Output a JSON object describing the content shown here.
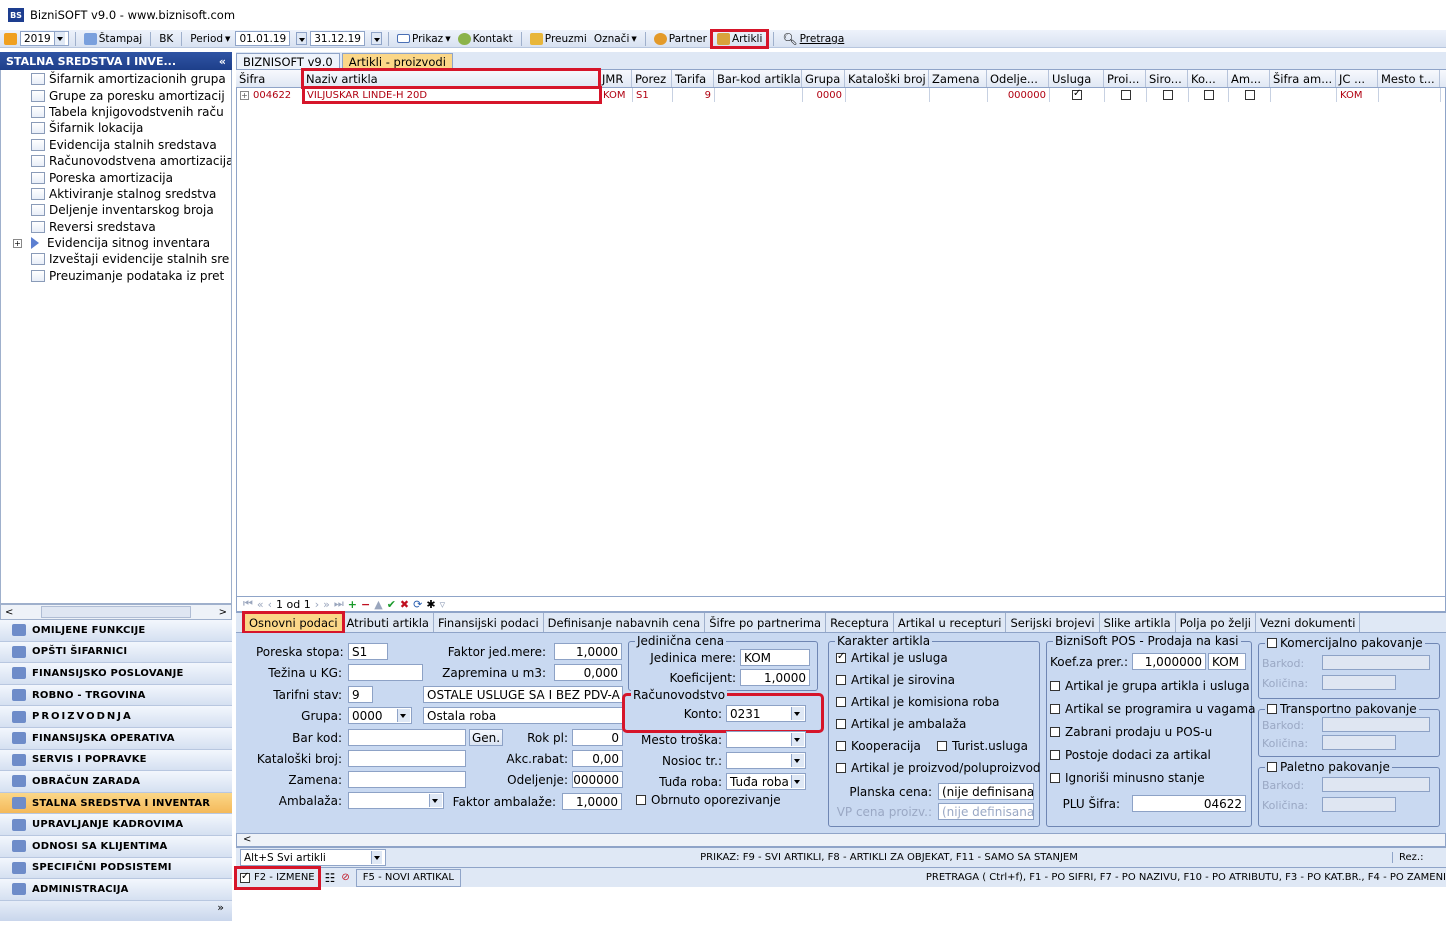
{
  "app": {
    "title": "BizniSOFT v9.0 - www.biznisoft.com",
    "icon": "BS"
  },
  "toolbar": {
    "year": "2019",
    "stampaj": "Štampaj",
    "bk": "BK",
    "period": "Period",
    "from": "01.01.19",
    "to": "31.12.19",
    "prikaz": "Prikaz",
    "kontakt": "Kontakt",
    "preuzmi": "Preuzmi",
    "oznaci": "Označi",
    "partner": "Partner",
    "artikli": "Artikli",
    "pretraga": "Pretraga"
  },
  "left": {
    "header": "STALNA SREDSTVA I INVE...",
    "collapse": "«",
    "tree": [
      "Šifarnik amortizacionih grupa",
      "Grupe za poresku amortizacij",
      "Tabela knjigovodstvenih raču",
      "Šifarnik lokacija",
      "Evidencija stalnih sredstava",
      "Računovodstvena amortizacija",
      "Poreska amortizacija",
      "Aktiviranje stalnog sredstva",
      "Deljenje inventarskog broja",
      "Reversi sredstava",
      "Evidencija sitnog inventara",
      "Izveštaji evidencije stalnih sre",
      "Preuzimanje podataka iz pret"
    ],
    "modules": [
      "OMILJENE FUNKCIJE",
      "OPŠTI ŠIFARNICI",
      "FINANSIJSKO POSLOVANJE",
      "ROBNO - TRGOVINA",
      "PROIZVODNJA",
      "FINANSIJSKA OPERATIVA",
      "SERVIS I POPRAVKE",
      "OBRAČUN ZARADA",
      "STALNA SREDSTVA I INVENTAR",
      "UPRAVLJANJE KADROVIMA",
      "ODNOSI SA KLIJENTIMA",
      "SPECIFIČNI PODSISTEMI",
      "ADMINISTRACIJA"
    ],
    "bottom": "»"
  },
  "tabs": [
    "BIZNISOFT v9.0",
    "Artikli - proizvodi"
  ],
  "grid": {
    "headers": [
      "Šifra",
      "Naziv artikla",
      "JMR",
      "Porez",
      "Tarifa",
      "Bar-kod artikla",
      "Grupa",
      "Kataloški broj",
      "Zamena",
      "Odelje...",
      "Usluga",
      "Proi...",
      "Siro...",
      "Ko...",
      "Am...",
      "Šifra am...",
      "JC ...",
      "Mesto t..."
    ],
    "row": {
      "sifra": "004622",
      "naziv": "VILJUSKAR LINDE-H 20D",
      "jmr": "KOM",
      "porez": "S1",
      "tarifa": "9",
      "grupa": "0000",
      "odeljenje": "000000",
      "jc": "KOM"
    }
  },
  "nav": {
    "pages": "1 od 1"
  },
  "detail_tabs": [
    "Osnovni podaci",
    "Atributi artikla",
    "Finansijski podaci",
    "Definisanje nabavnih cena",
    "Šifre po partnerima",
    "Receptura",
    "Artikal u recepturi",
    "Serijski brojevi",
    "Slike artikla",
    "Polja po želji",
    "Vezni dokumenti"
  ],
  "form": {
    "poreska_stopa_l": "Poreska stopa:",
    "poreska_stopa": "S1",
    "tezina_l": "Težina u KG:",
    "tarifni_l": "Tarifni stav:",
    "tarifni": "9",
    "tarifni_opis": "OSTALE USLUGE SA I BEZ PDV-A",
    "grupa_l": "Grupa:",
    "grupa": "0000",
    "grupa_opis": "Ostala roba",
    "barkod_l": "Bar kod:",
    "gen": "Gen.",
    "rok_l": "Rok pl:",
    "rok": "0",
    "katbroj_l": "Kataloški broj:",
    "akc_l": "Akc.rabat:",
    "akc": "0,00",
    "zamena_l": "Zamena:",
    "odelj_l": "Odeljenje:",
    "odelj": "000000",
    "ambalaza_l": "Ambalaža:",
    "faktor_amb_l": "Faktor ambalaže:",
    "faktor_amb": "1,0000",
    "faktor_jm_l": "Faktor jed.mere:",
    "faktor_jm": "1,0000",
    "zapremina_l": "Zapremina u m3:",
    "zapremina": "0,000",
    "jc_title": "Jedinična cena",
    "jm_l": "Jedinica mere:",
    "jm": "KOM",
    "koef_l": "Koeficijent:",
    "koef": "1,0000",
    "rac_title": "Računovodstvo",
    "konto_l": "Konto:",
    "konto": "0231",
    "mesto_l": "Mesto troška:",
    "nosioc_l": "Nosioc tr.:",
    "tudja_l": "Tuđa roba:",
    "tudja": "Tuđa roba",
    "obrnuto": "Obrnuto oporezivanje",
    "kar_title": "Karakter artikla",
    "k1": "Artikal je usluga",
    "k2": "Artikal je sirovina",
    "k3": "Artikal je komisiona roba",
    "k4": "Artikal je ambalaža",
    "k5": "Kooperacija",
    "k5b": "Turist.usluga",
    "k6": "Artikal je proizvod/poluproizvod",
    "planska_l": "Planska cena:",
    "planska": "(nije definisana)",
    "vp_l": "VP cena proizv.:",
    "vp": "(nije definisana)",
    "pos_title": "BizniSoft POS - Prodaja na kasi",
    "koefp_l": "Koef.za prer.:",
    "koefp": "1,000000",
    "koefp_jm": "KOM",
    "p1": "Artikal je grupa artikla i usluga",
    "p2": "Artikal se programira u vagama",
    "p3": "Zabrani prodaju u POS-u",
    "p4": "Postoje dodaci za artikal",
    "p5": "Ignoriši minusno stanje",
    "plu_l": "PLU Šifra:",
    "plu": "04622",
    "kom_title": "Komercijalno pakovanje",
    "tr_title": "Transportno pakovanje",
    "pal_title": "Paletno pakovanje",
    "barkod": "Barkod:",
    "kolicina": "Količina:"
  },
  "status1": {
    "filter": "Alt+S Svi artikli",
    "info": "PRIKAZ: F9 - SVI ARTIKLI, F8 - ARTIKLI ZA OBJEKAT, F11 - SAMO SA STANJEM",
    "rez": "Rez.:"
  },
  "status2": {
    "izmene": "F2 - IZMENE",
    "novi": "F5 - NOVI ARTIKAL",
    "pretraga": "PRETRAGA ( Ctrl+f), F1 - PO ŠIFRI, F7 - PO NAZIVU, F10 - PO ATRIBUTU, F3 - PO KAT.BR., F4 - PO ZAMENI"
  }
}
